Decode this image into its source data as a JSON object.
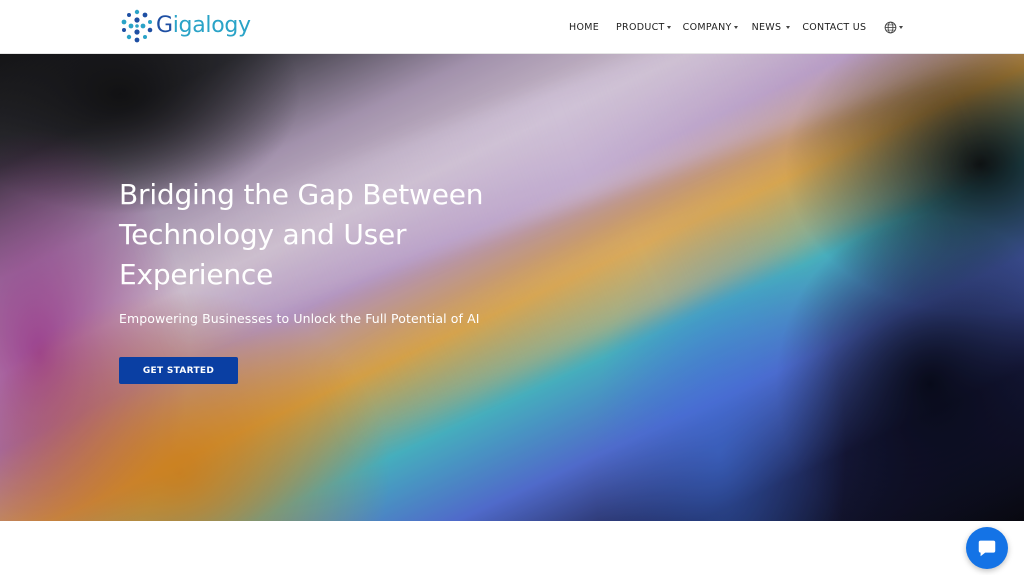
{
  "brand": {
    "name_first": "G",
    "name_rest": "igalogy",
    "logo_icon": "molecule-dots-logo"
  },
  "nav": {
    "items": [
      {
        "label": "HOME",
        "has_dropdown": false
      },
      {
        "label": "PRODUCT",
        "has_dropdown": true
      },
      {
        "label": "COMPANY",
        "has_dropdown": true
      },
      {
        "label": "NEWS",
        "has_dropdown": true
      },
      {
        "label": "CONTACT US",
        "has_dropdown": false
      }
    ],
    "language_icon": "globe-icon"
  },
  "hero": {
    "title": "Bridging the Gap Between Technology and User Experience",
    "subtitle": "Empowering Businesses to Unlock the Full Potential of AI",
    "cta_label": "GET STARTED"
  },
  "chat": {
    "icon": "chat-bubble-icon"
  },
  "colors": {
    "brand_dark_blue": "#1e4fa3",
    "brand_light_blue": "#2aa3c7",
    "cta_blue": "#0a3fa3",
    "chat_blue": "#1473e6"
  }
}
